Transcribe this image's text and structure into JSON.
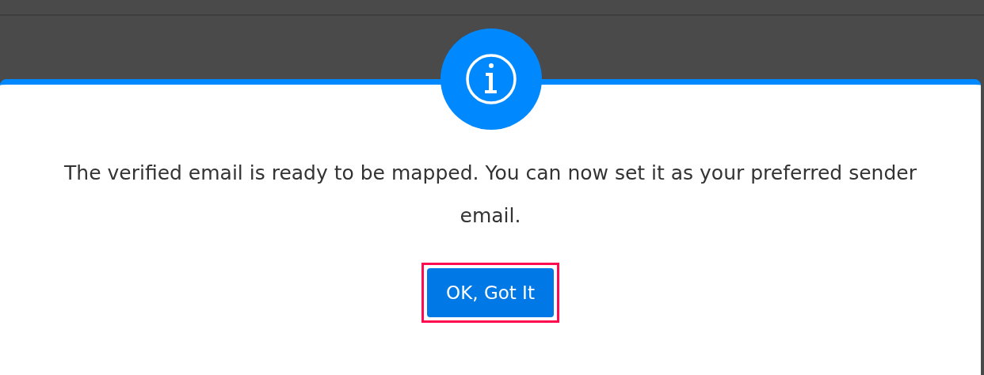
{
  "dialog": {
    "kind": "info",
    "message": "The verified email is ready to be mapped. You can now set it as your preferred sender email.",
    "button": {
      "label": "OK, Got It",
      "focused": true
    }
  }
}
